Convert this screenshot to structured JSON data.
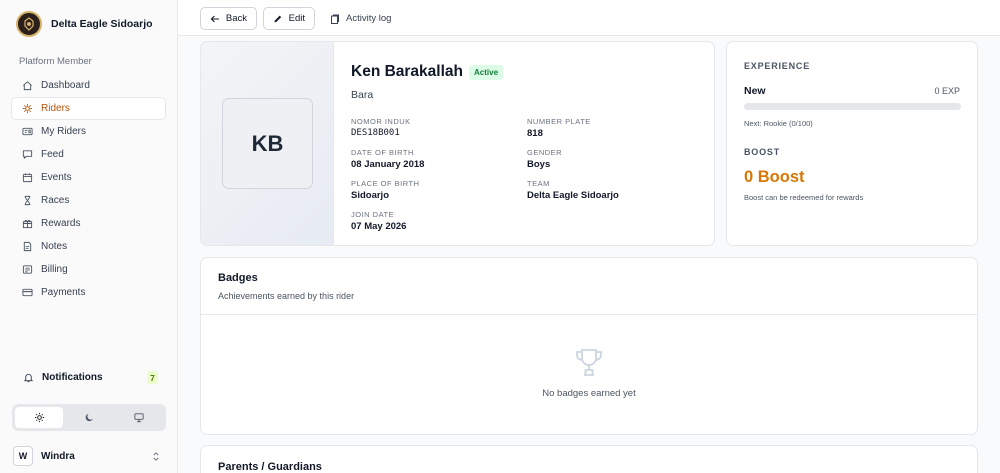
{
  "brand": {
    "name": "Delta Eagle Sidoarjo"
  },
  "sidebar": {
    "section_label": "Platform Member",
    "items": [
      {
        "label": "Dashboard",
        "icon": "home-icon"
      },
      {
        "label": "Riders",
        "icon": "bike-icon"
      },
      {
        "label": "My Riders",
        "icon": "id-card-icon"
      },
      {
        "label": "Feed",
        "icon": "message-icon"
      },
      {
        "label": "Events",
        "icon": "calendar-icon"
      },
      {
        "label": "Races",
        "icon": "hourglass-icon"
      },
      {
        "label": "Rewards",
        "icon": "gift-icon"
      },
      {
        "label": "Notes",
        "icon": "file-icon"
      },
      {
        "label": "Billing",
        "icon": "receipt-icon"
      },
      {
        "label": "Payments",
        "icon": "credit-card-icon"
      }
    ],
    "active_item": "Riders",
    "notifications": {
      "label": "Notifications",
      "count": "7"
    },
    "user": {
      "initial": "W",
      "name": "Windra"
    }
  },
  "toolbar": {
    "back_label": "Back",
    "edit_label": "Edit",
    "activity_label": "Activity log"
  },
  "profile": {
    "initials": "KB",
    "name": "Ken Barakallah",
    "status": "Active",
    "nickname": "Bara",
    "fields": {
      "nomor_induk": {
        "label": "Nomor Induk",
        "value": "DES18B001"
      },
      "number_plate": {
        "label": "Number Plate",
        "value": "818"
      },
      "dob": {
        "label": "Date of Birth",
        "value": "08 January 2018"
      },
      "gender": {
        "label": "Gender",
        "value": "Boys"
      },
      "pob": {
        "label": "Place of Birth",
        "value": "Sidoarjo"
      },
      "team": {
        "label": "Team",
        "value": "Delta Eagle Sidoarjo"
      },
      "join": {
        "label": "Join Date",
        "value": "07 May 2026"
      }
    }
  },
  "experience": {
    "heading": "EXPERIENCE",
    "level": "New",
    "exp": "0 EXP",
    "progress_fraction": 0,
    "next": "Next: Rookie (0/100)",
    "boost_heading": "BOOST",
    "boost_value": "0 Boost",
    "boost_note": "Boost can be redeemed for rewards"
  },
  "badges": {
    "title": "Badges",
    "subtitle": "Achievements earned by this rider",
    "empty": "No badges earned yet"
  },
  "parents": {
    "title": "Parents / Guardians"
  },
  "colors": {
    "accent": "#d97706",
    "active_nav": "#b45309",
    "status_bg": "#dcfce7",
    "status_fg": "#15803d"
  }
}
